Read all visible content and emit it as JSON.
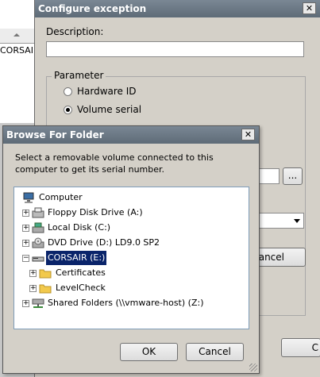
{
  "background": {
    "list_item_text": "CORSAIR"
  },
  "configure_dialog": {
    "title": "Configure exception",
    "description_label": "Description:",
    "description_value": "",
    "parameter_group_label": "Parameter",
    "radio_hardware_id": "Hardware ID",
    "radio_volume_serial": "Volume serial",
    "selected_radio": "Volume serial",
    "browse_button": "...",
    "cancel_button_partial": "ancel",
    "cancel_button_bottom_partial": "C"
  },
  "browse_dialog": {
    "title": "Browse For Folder",
    "instruction": "Select a removable volume connected to this computer to get its serial number.",
    "tree": [
      {
        "label": "Computer",
        "icon": "computer-icon",
        "level": 0,
        "expander": ""
      },
      {
        "label": "Floppy Disk Drive (A:)",
        "icon": "floppy-icon",
        "level": 1,
        "expander": "+"
      },
      {
        "label": "Local Disk (C:)",
        "icon": "hard-drive-icon",
        "level": 1,
        "expander": "+"
      },
      {
        "label": "DVD Drive (D:) LD9.0 SP2",
        "icon": "dvd-icon",
        "level": 1,
        "expander": "+"
      },
      {
        "label": "CORSAIR (E:)",
        "icon": "removable-drive-icon",
        "level": 1,
        "expander": "−",
        "selected": true
      },
      {
        "label": "Certificates",
        "icon": "folder-icon",
        "level": 2,
        "expander": "+"
      },
      {
        "label": "LevelCheck",
        "icon": "folder-icon",
        "level": 2,
        "expander": "+"
      },
      {
        "label": "Shared Folders (\\\\vmware-host) (Z:)",
        "icon": "network-drive-icon",
        "level": 1,
        "expander": "+"
      }
    ],
    "ok_label": "OK",
    "cancel_label": "Cancel"
  },
  "colors": {
    "selection": "#0a246a",
    "dialog_face": "#d4d0c8",
    "title_bar": "#6a7783"
  }
}
